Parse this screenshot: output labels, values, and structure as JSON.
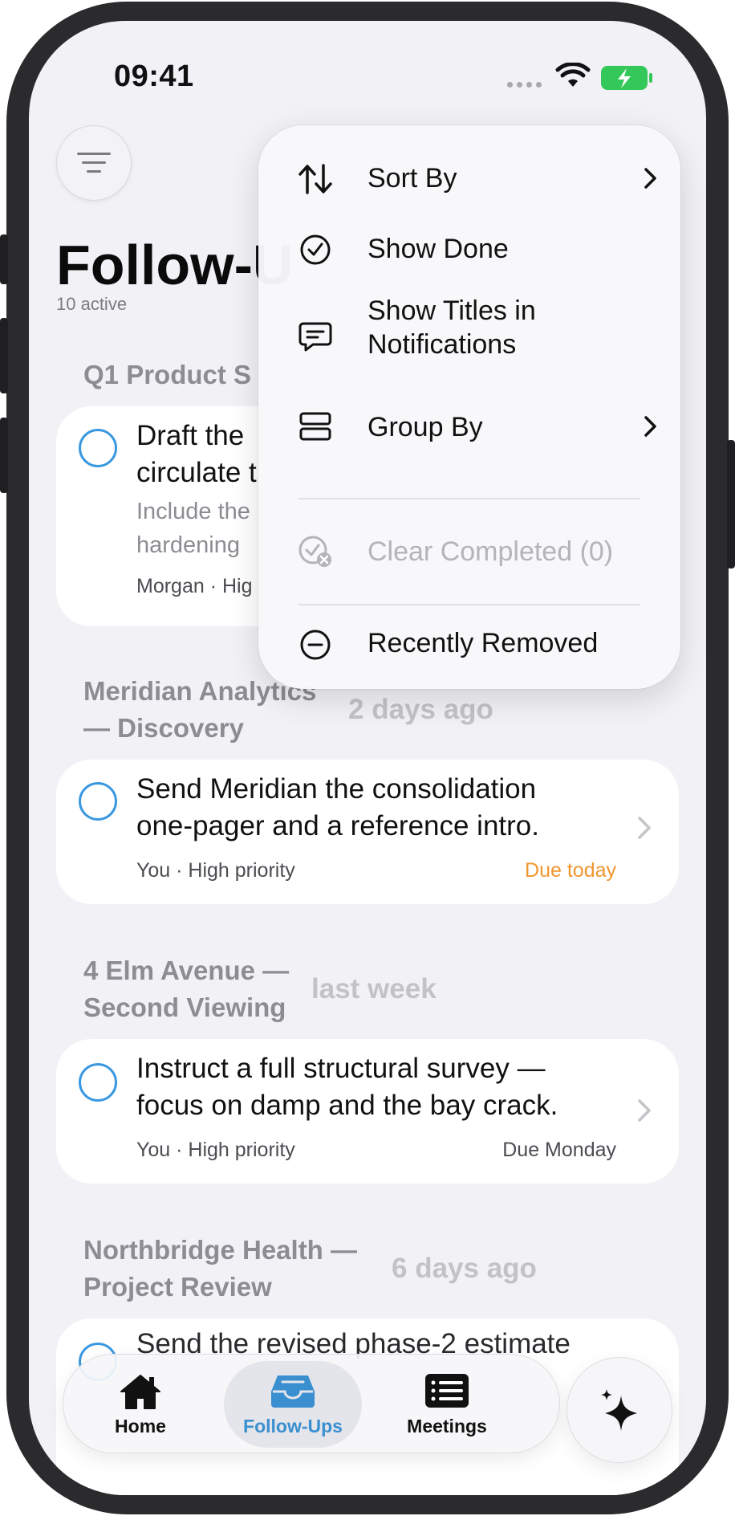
{
  "status_bar": {
    "time": "09:41"
  },
  "header": {
    "title": "Follow-U",
    "subtitle": "10 active"
  },
  "sections": [
    {
      "title": "Q1 Product S",
      "cards": [
        {
          "title_lines": [
            "Draft the",
            "circulate t"
          ],
          "note_lines": [
            "Include the",
            "hardening"
          ],
          "meta": "Morgan · Hig"
        }
      ]
    },
    {
      "title_lines": [
        "Meridian Analytics",
        "— Discovery"
      ],
      "time": "2 days ago",
      "cards": [
        {
          "title_lines": [
            "Send Meridian the consolidation",
            "one-pager and a reference intro."
          ],
          "meta": "You · High priority",
          "due": "Due today",
          "due_color": "#f0962e"
        }
      ]
    },
    {
      "title_lines": [
        "4 Elm Avenue —",
        "Second Viewing"
      ],
      "time": "last week",
      "cards": [
        {
          "title_lines": [
            "Instruct a full structural survey —",
            "focus on damp and the bay crack."
          ],
          "meta": "You · High priority",
          "due": "Due Monday",
          "due_color": "#4c4c52"
        }
      ]
    },
    {
      "title_lines": [
        "Northbridge Health —",
        "Project Review"
      ],
      "time": "6 days ago",
      "cards": [
        {
          "title_partial": "Send the revised phase-2 estimate"
        }
      ]
    }
  ],
  "dropdown": {
    "items": [
      {
        "label": "Sort By",
        "icon": "sort-arrows-icon",
        "has_submenu": true
      },
      {
        "label": "Show Done",
        "icon": "checkmark-circle-icon"
      },
      {
        "label_lines": [
          "Show Titles in",
          "Notifications"
        ],
        "icon": "message-bubble-icon"
      },
      {
        "label": "Group By",
        "icon": "group-rows-icon",
        "has_submenu": true
      },
      {
        "label": "Clear Completed (0)",
        "icon": "clear-completed-icon",
        "disabled": true
      },
      {
        "label": "Recently Removed",
        "icon": "minus-circle-icon"
      }
    ]
  },
  "tab_bar": {
    "tabs": [
      {
        "label": "Home",
        "icon": "house-icon",
        "active": false
      },
      {
        "label": "Follow-Ups",
        "icon": "inbox-tray-icon",
        "active": true
      },
      {
        "label": "Meetings",
        "icon": "list-icon",
        "active": false
      }
    ],
    "ai_button_icon": "sparkle-icon"
  },
  "colors": {
    "accent": "#3a8fd0",
    "checkbox": "#3a98e0",
    "due_today": "#f0962e",
    "battery": "#34c759"
  }
}
